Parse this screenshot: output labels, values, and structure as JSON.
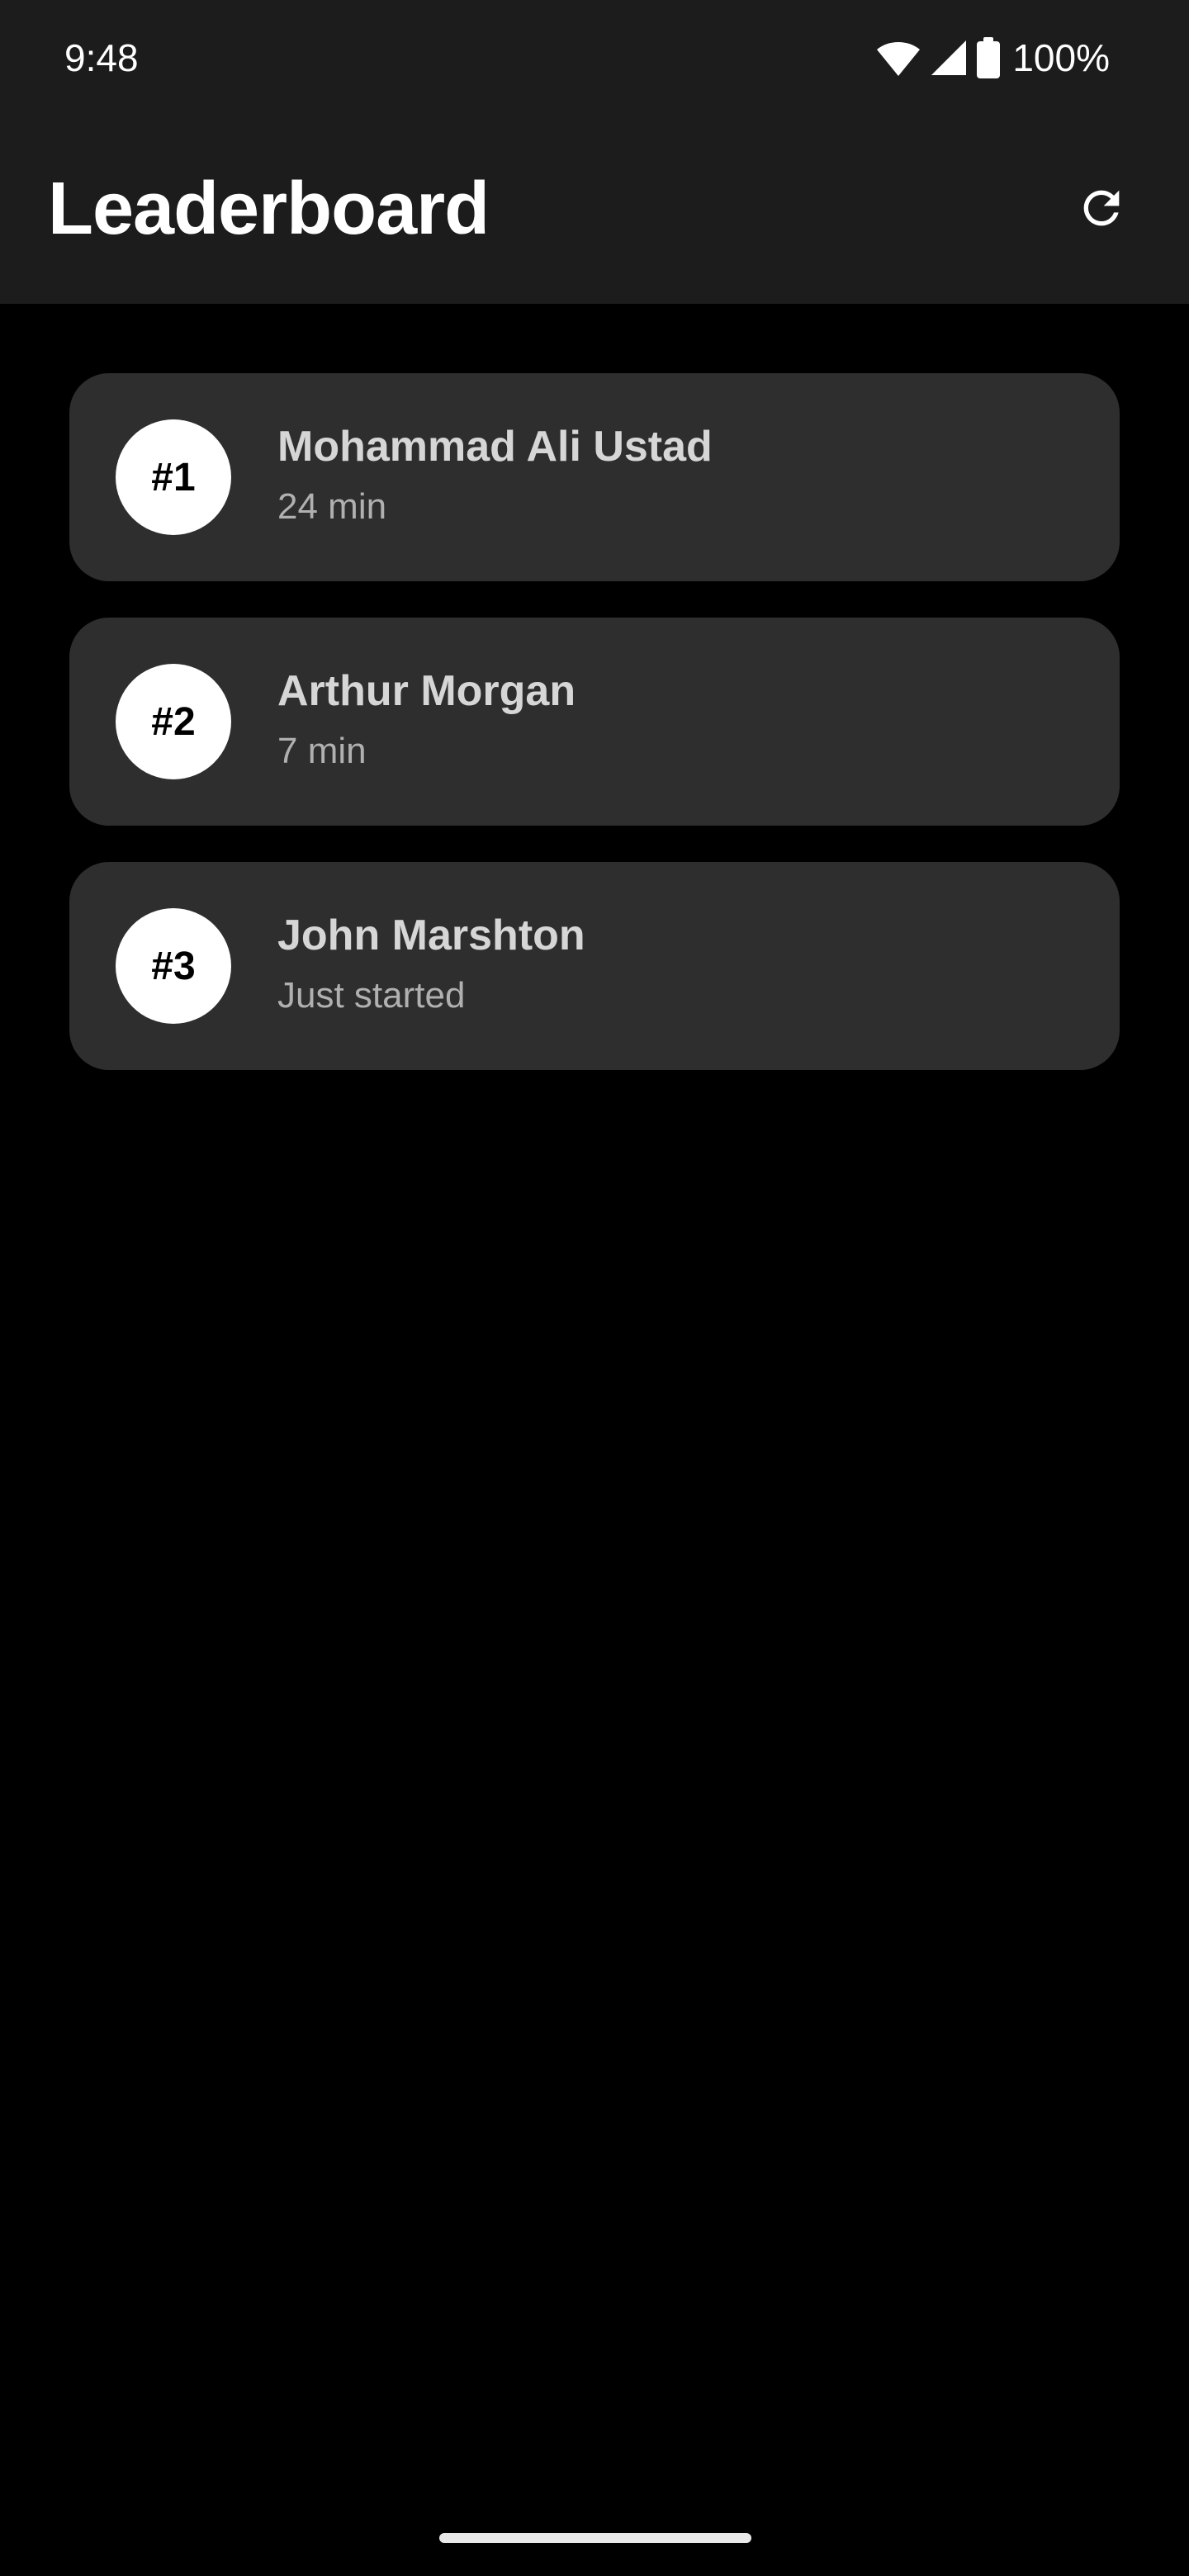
{
  "status_bar": {
    "time": "9:48",
    "battery_percent": "100%",
    "icons": [
      "wifi-icon",
      "cell-signal-icon",
      "battery-icon"
    ]
  },
  "app_bar": {
    "title": "Leaderboard",
    "refresh_icon": "refresh-icon"
  },
  "leaderboard": [
    {
      "rank": "#1",
      "name": "Mohammad Ali Ustad",
      "time": "24 min"
    },
    {
      "rank": "#2",
      "name": "Arthur Morgan",
      "time": "7 min"
    },
    {
      "rank": "#3",
      "name": "John Marshton",
      "time": "Just started"
    }
  ],
  "colors": {
    "background": "#000000",
    "app_bar": "#1c1c1c",
    "card": "#2e2e2e",
    "badge": "#ffffff",
    "name_text": "#d6d6d6",
    "secondary_text": "#b0b0b0"
  }
}
